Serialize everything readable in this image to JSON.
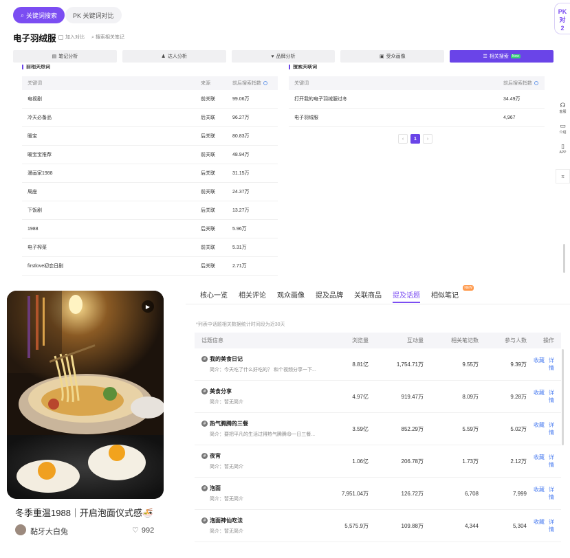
{
  "header": {
    "mode_active": "关键词搜索",
    "mode_pk": "PK 关键词对比",
    "pk_float": [
      "PK",
      "对",
      "2"
    ],
    "keyword": "电子羽绒服",
    "add_compare": "加入对比",
    "search_notes": "搜索相关笔记"
  },
  "tabs": [
    {
      "label": "笔记分析",
      "icon": "note-icon",
      "active": false
    },
    {
      "label": "达人分析",
      "icon": "user-icon",
      "active": false
    },
    {
      "label": "品牌分析",
      "icon": "heart-icon",
      "active": false
    },
    {
      "label": "受众画像",
      "icon": "audience-icon",
      "active": false
    },
    {
      "label": "相关搜索",
      "icon": "list-icon",
      "active": true,
      "badge": "New"
    }
  ],
  "left_section": {
    "title": "前相关热词",
    "columns": [
      "关键词",
      "来源",
      "前后搜索指数"
    ],
    "rows": [
      {
        "keyword": "电视剧",
        "source": "前关联",
        "index": "99.06万"
      },
      {
        "keyword": "冷天必备品",
        "source": "后关联",
        "index": "96.27万"
      },
      {
        "keyword": "暖宝",
        "source": "后关联",
        "index": "80.83万"
      },
      {
        "keyword": "暖宝宝推荐",
        "source": "前关联",
        "index": "48.94万"
      },
      {
        "keyword": "漫画家1988",
        "source": "后关联",
        "index": "31.15万"
      },
      {
        "keyword": "局座",
        "source": "前关联",
        "index": "24.37万"
      },
      {
        "keyword": "下饭剧",
        "source": "后关联",
        "index": "13.27万"
      },
      {
        "keyword": "1988",
        "source": "后关联",
        "index": "5.96万"
      },
      {
        "keyword": "电子榨菜",
        "source": "前关联",
        "index": "5.31万"
      },
      {
        "keyword": "firstlove初恋日剧",
        "source": "后关联",
        "index": "2.71万"
      }
    ]
  },
  "right_section": {
    "title": "搜索关联词",
    "columns": [
      "关键词",
      "前后搜索指数"
    ],
    "rows": [
      {
        "keyword": "打开我的电子羽绒服过冬",
        "index": "34.49万"
      },
      {
        "keyword": "电子羽绒服",
        "index": "4,967"
      }
    ],
    "pager": {
      "prev": "‹",
      "current": "1",
      "next": "›"
    }
  },
  "side_tools": [
    {
      "icon": "headset-icon",
      "label": "客服"
    },
    {
      "icon": "doc-icon",
      "label": "介绍"
    },
    {
      "icon": "phone-icon",
      "label": "APP"
    }
  ],
  "side_scroll_icon": "⌅",
  "video_card": {
    "title": "冬季重温1988｜开启泡面仪式感🍜",
    "author": "黏牙大白兔",
    "likes": "992",
    "play_icon": "▶"
  },
  "content_tabs": [
    {
      "label": "核心一览",
      "active": false
    },
    {
      "label": "相关评论",
      "active": false
    },
    {
      "label": "观众画像",
      "active": false
    },
    {
      "label": "提及品牌",
      "active": false
    },
    {
      "label": "关联商品",
      "active": false
    },
    {
      "label": "提及话题",
      "active": true
    },
    {
      "label": "相似笔记",
      "active": false,
      "tag": "NEW"
    }
  ],
  "topic_note": "*列表中话题相关数据统计时间段为近30天",
  "topic_table": {
    "columns": [
      "话题信息",
      "浏览量",
      "互动量",
      "相关笔记数",
      "参与人数",
      "操作"
    ],
    "rows": [
      {
        "name": "我的美食日记",
        "desc": "简介：今天吃了什么好吃的？ 和个视频分享一下...",
        "views": "8.81亿",
        "interact": "1,754.71万",
        "notes": "9.55万",
        "people": "9.39万"
      },
      {
        "name": "美食分享",
        "desc": "简介：暂无简介",
        "views": "4.97亿",
        "interact": "919.47万",
        "notes": "8.09万",
        "people": "9.28万"
      },
      {
        "name": "热气腾腾的三餐",
        "desc": "简介：要把平凡的生活过得热气腾腾😋一日三餐...",
        "views": "3.59亿",
        "interact": "852.29万",
        "notes": "5.59万",
        "people": "5.02万"
      },
      {
        "name": "夜宵",
        "desc": "简介：暂无简介",
        "views": "1.06亿",
        "interact": "206.78万",
        "notes": "1.73万",
        "people": "2.12万"
      },
      {
        "name": "泡面",
        "desc": "简介：暂无简介",
        "views": "7,951.04万",
        "interact": "126.72万",
        "notes": "6,708",
        "people": "7,999"
      },
      {
        "name": "泡面神仙吃法",
        "desc": "简介：暂无简介",
        "views": "5,575.9万",
        "interact": "109.88万",
        "notes": "4,344",
        "people": "5,304"
      }
    ],
    "op_collect": "收藏",
    "op_detail": "详情"
  },
  "colors": {
    "accent": "#7b4df2",
    "link": "#4a7cf0"
  }
}
